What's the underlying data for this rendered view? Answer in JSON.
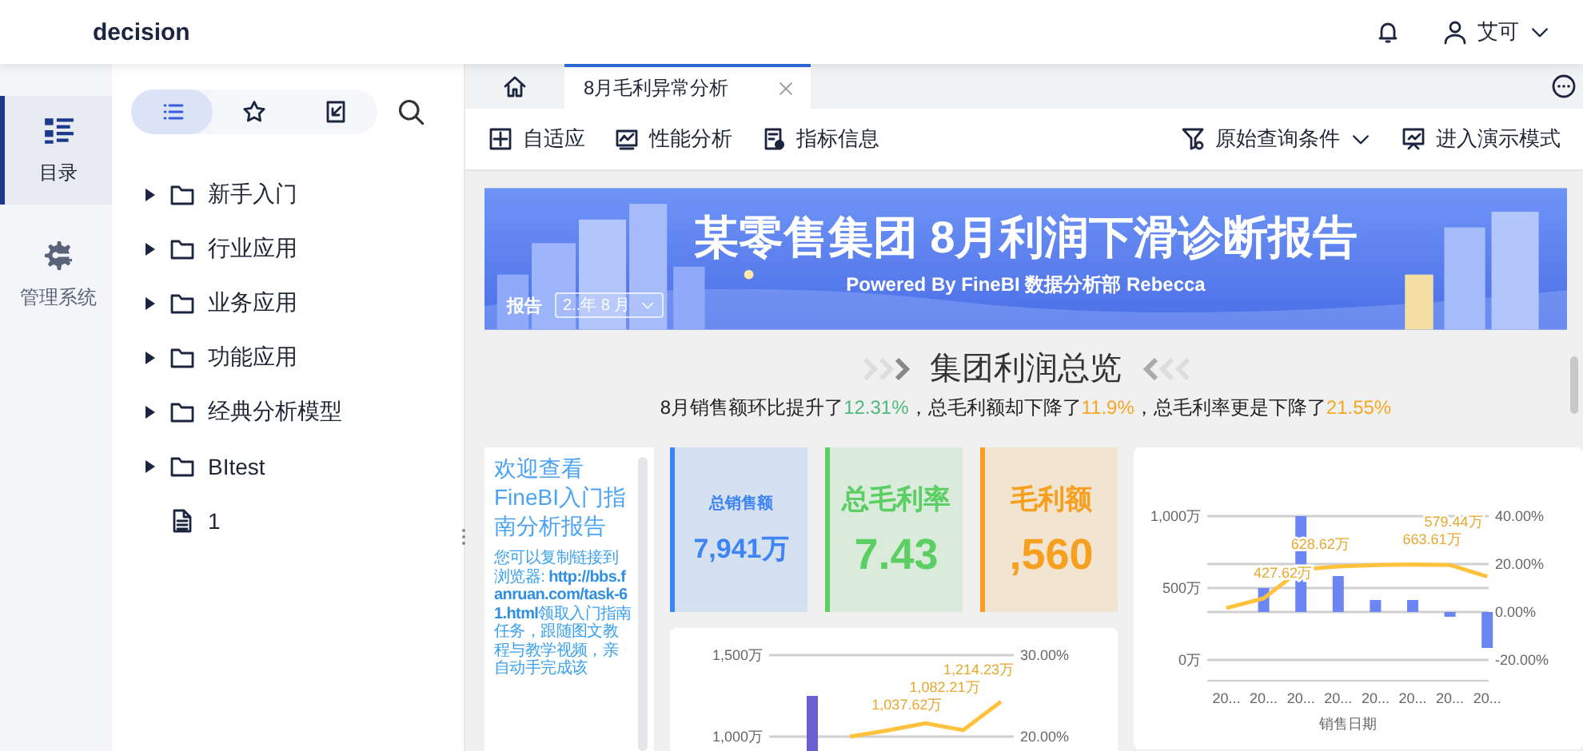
{
  "app": {
    "title": "decision",
    "user": "艾可"
  },
  "rail": [
    {
      "label": "目录",
      "kind": "catalog",
      "selected": true
    },
    {
      "label": "管理系统",
      "kind": "gear",
      "selected": false
    }
  ],
  "tree_views": [
    {
      "kind": "list",
      "selected": true
    },
    {
      "kind": "star",
      "selected": false
    },
    {
      "kind": "import",
      "selected": false
    }
  ],
  "tree": [
    {
      "label": "新手入门",
      "kind": "folder",
      "expanded": false
    },
    {
      "label": "行业应用",
      "kind": "folder",
      "expanded": false
    },
    {
      "label": "业务应用",
      "kind": "folder",
      "expanded": false
    },
    {
      "label": "功能应用",
      "kind": "folder",
      "expanded": false
    },
    {
      "label": "经典分析模型",
      "kind": "folder",
      "expanded": false
    },
    {
      "label": "BItest",
      "kind": "folder",
      "expanded": false
    },
    {
      "label": "1",
      "kind": "file"
    }
  ],
  "tabs": [
    {
      "label": "8月毛利异常分析",
      "selected": true
    }
  ],
  "toolbar": {
    "left": [
      {
        "label": "自适应",
        "kind": "fit"
      },
      {
        "label": "性能分析",
        "kind": "performance"
      },
      {
        "label": "指标信息",
        "kind": "info"
      }
    ],
    "right": [
      {
        "label": "原始查询条件",
        "kind": "filter",
        "dropdown": true
      },
      {
        "label": "进入演示模式",
        "kind": "present",
        "dropdown": false
      }
    ]
  },
  "banner": {
    "title": "某零售集团 8月利润下滑诊断报告",
    "subtitle": "Powered By FineBI 数据分析部 Rebecca",
    "filter_label": "报告",
    "filter_value": "2..年 8 月"
  },
  "section": {
    "title": "集团利润总览",
    "summary": [
      {
        "text": "8月销售额环比提升了"
      },
      {
        "text": "12.31%",
        "color": "#4cb87c"
      },
      {
        "text": "，总毛利额却下降了"
      },
      {
        "text": "11.9%",
        "color": "#f5a623"
      },
      {
        "text": "，总毛利率更是下降了"
      },
      {
        "text": "21.55%",
        "color": "#f5a623"
      }
    ]
  },
  "intro": {
    "title": "欢迎查看FineBI入门指南分析报告",
    "body": "您可以复制链接到浏览器: **http://bbs.fanruan.com/task-61.html**领取入门指南任务，跟随图文教程与教学视频，亲自动手完成该"
  },
  "kpis": [
    {
      "label": "总销售额",
      "value": "7,941万",
      "color": "#3d85f5",
      "kind": "compact"
    },
    {
      "label": "总毛利率",
      "value": "7.43",
      "color": "#5ccf64",
      "kind": "prominent"
    },
    {
      "label": "毛利额",
      "value": ",560",
      "color": "#f7a020",
      "kind": "prominent"
    }
  ],
  "charts": [
    {
      "chart_data": {
        "type": "bar",
        "ylim": [
          1000,
          1500
        ],
        "y2lim": [
          20,
          30
        ],
        "yticks": [
          {
            "value": 1000,
            "label": "1,000万"
          },
          {
            "value": 1500,
            "label": "1,500万"
          }
        ],
        "y2ticks": [
          {
            "value": 20,
            "label": "20.00%"
          },
          {
            "value": 30,
            "label": "30.00%"
          }
        ],
        "series": [
          {
            "type": "bar",
            "axis": "y2",
            "color": "#6a5fd0",
            "values": [
              25,
              null,
              null,
              null,
              null,
              null
            ]
          },
          {
            "type": "line",
            "color": "#ffc23d",
            "values": [
              null,
              1000,
              1037.62,
              1082.21,
              1040,
              1214.23
            ]
          }
        ],
        "value_labels": [
          null,
          null,
          "1,037.62万",
          "1,082.21万",
          null,
          "1,214.23万"
        ]
      }
    },
    {
      "chart_data": {
        "type": "bar",
        "xlabel": "销售日期",
        "categories": [
          "20...",
          "20...",
          "20...",
          "20...",
          "20...",
          "20...",
          "20...",
          "20..."
        ],
        "grid": true,
        "ylim": [
          0,
          1000
        ],
        "y2lim": [
          -20,
          40
        ],
        "yticks": [
          {
            "value": 0,
            "label": "0万"
          },
          {
            "value": 500,
            "label": "500万"
          },
          {
            "value": 1000,
            "label": "1,000万"
          }
        ],
        "y2ticks": [
          {
            "value": -20,
            "label": "-20.00%"
          },
          {
            "value": 0,
            "label": "0.00%"
          },
          {
            "value": 20,
            "label": "20.00%"
          },
          {
            "value": 40,
            "label": "40.00%"
          }
        ],
        "series": [
          {
            "type": "bar",
            "axis": "y2",
            "color": "#6b86f2",
            "values": [
              null,
              10,
              40,
              15,
              5,
              5,
              -2,
              -15
            ]
          },
          {
            "type": "line",
            "color": "#ffc23d",
            "values": [
              360,
              427.62,
              628.62,
              650,
              660,
              663.61,
              660,
              579.44
            ]
          }
        ],
        "value_labels": [
          null,
          "427.62万",
          "628.62万",
          null,
          null,
          "663.61万",
          null,
          "579.44万"
        ]
      }
    }
  ]
}
